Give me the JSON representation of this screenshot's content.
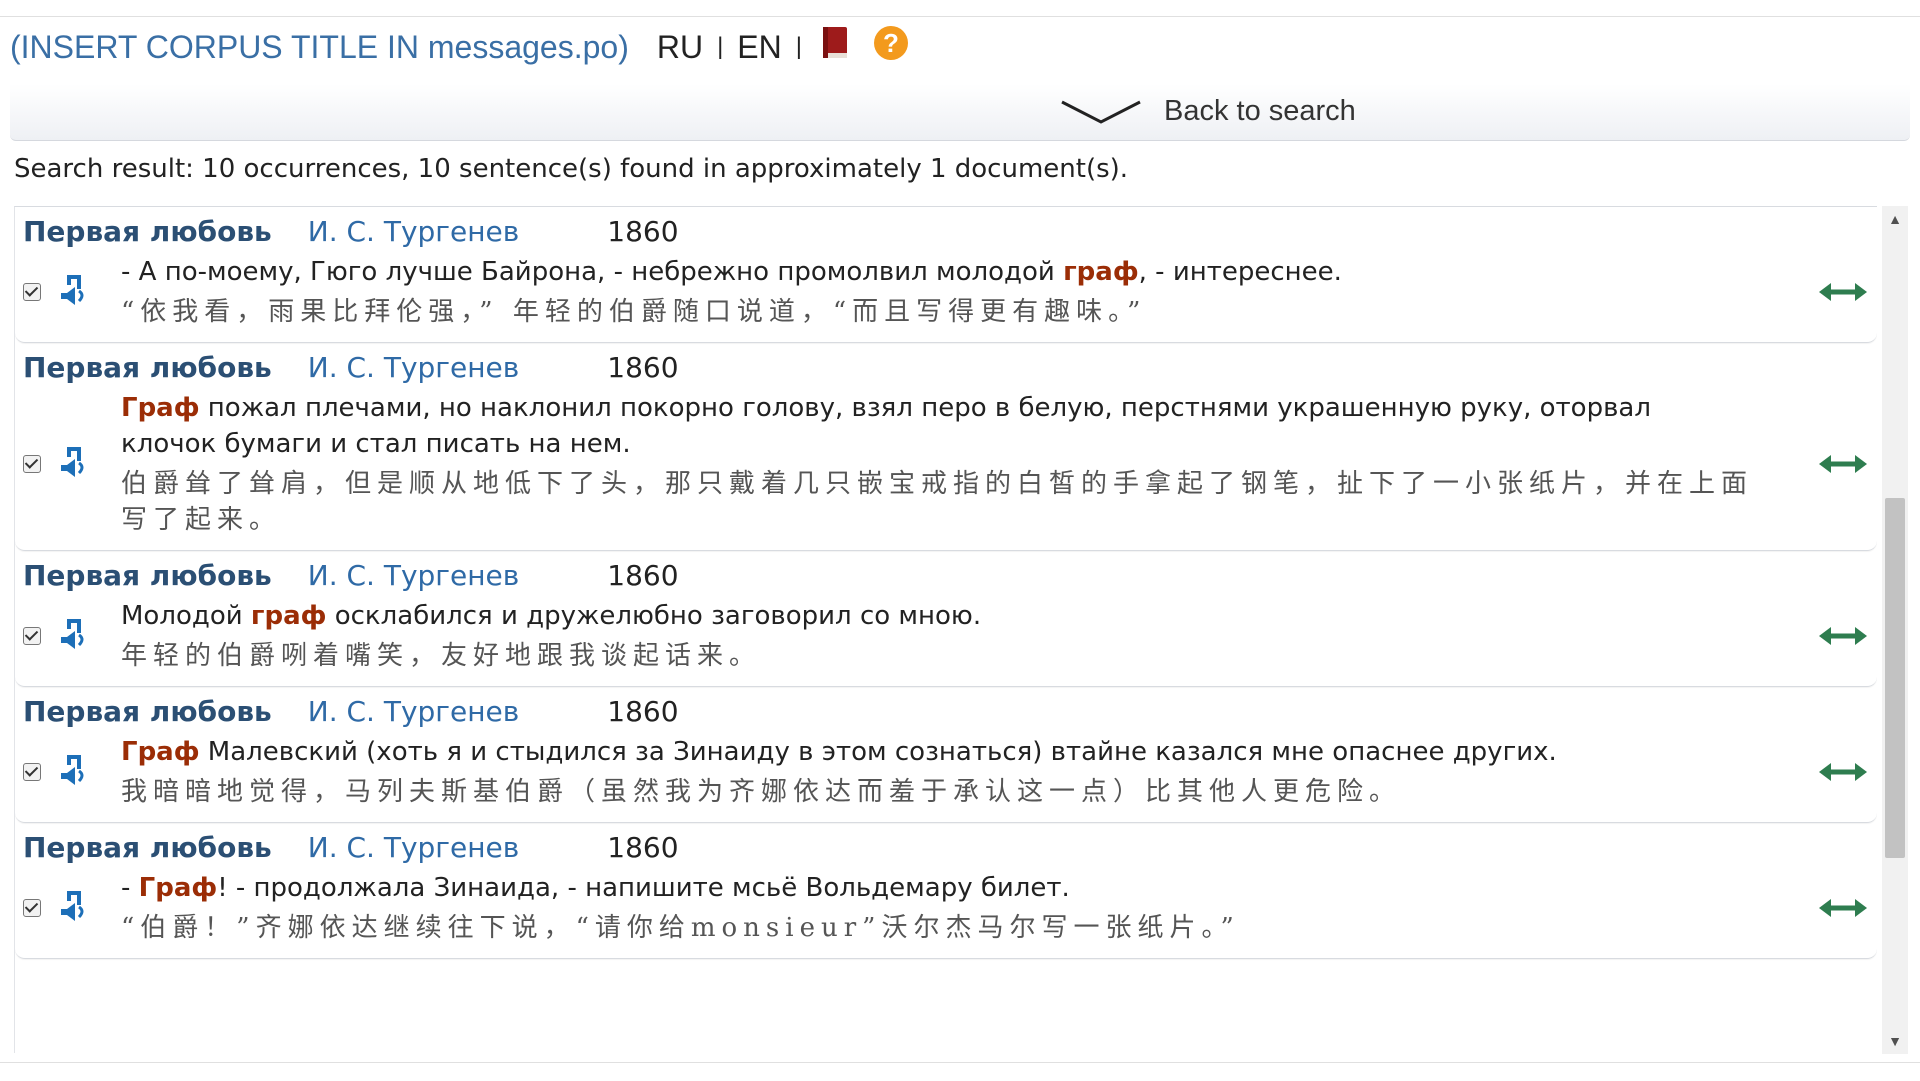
{
  "header": {
    "corpus_title": "(INSERT CORPUS TITLE IN messages.po)",
    "lang_ru": "RU",
    "lang_en": "EN",
    "separator": "|"
  },
  "back": {
    "label": "Back to search"
  },
  "summary": "Search result: 10 occurrences, 10 sentence(s) found in approximately 1 document(s).",
  "icons": {
    "book": "book-icon",
    "help": "help-icon",
    "chevron": "chevron-down-icon",
    "speaker": "speaker-icon",
    "swap": "swap-arrows-icon"
  },
  "colors": {
    "highlight": "#9b2d06",
    "title": "#2b4f74",
    "author": "#2f6aa6",
    "swap": "#2e7d4f",
    "help": "#f39a1d",
    "book": "#9e1b1b"
  },
  "results": [
    {
      "title": "Первая любовь",
      "author": "И. С. Тургенев",
      "year": "1860",
      "checked": true,
      "ru": [
        {
          "t": "- А по-моему, Гюго лучше Байрона, - небрежно промолвил молодой "
        },
        {
          "t": "граф",
          "h": true
        },
        {
          "t": ", - интереснее."
        }
      ],
      "zh": "“依我看，雨果比拜伦强，” 年轻的伯爵随口说道，“而且写得更有趣味。”"
    },
    {
      "title": "Первая любовь",
      "author": "И. С. Тургенев",
      "year": "1860",
      "checked": true,
      "ru": [
        {
          "t": "Граф",
          "h": true
        },
        {
          "t": " пожал плечами, но наклонил покорно голову, взял перо в белую, перстнями украшенную руку, оторвал клочок бумаги и стал писать на нем."
        }
      ],
      "zh": "伯爵耸了耸肩，但是顺从地低下了头，那只戴着几只嵌宝戒指的白皙的手拿起了钢笔，扯下了一小张纸片，并在上面写了起来。"
    },
    {
      "title": "Первая любовь",
      "author": "И. С. Тургенев",
      "year": "1860",
      "checked": true,
      "ru": [
        {
          "t": "Молодой "
        },
        {
          "t": "граф",
          "h": true
        },
        {
          "t": " осклабился и дружелюбно заговорил со мною."
        }
      ],
      "zh": "年轻的伯爵咧着嘴笑，友好地跟我谈起话来。"
    },
    {
      "title": "Первая любовь",
      "author": "И. С. Тургенев",
      "year": "1860",
      "checked": true,
      "ru": [
        {
          "t": "Граф",
          "h": true
        },
        {
          "t": " Малевский (хоть я и стыдился за Зинаиду в этом сознаться) втайне казался мне опаснее других."
        }
      ],
      "zh": "我暗暗地觉得，马列夫斯基伯爵（虽然我为齐娜依达而羞于承认这一点）比其他人更危险。"
    },
    {
      "title": "Первая любовь",
      "author": "И. С. Тургенев",
      "year": "1860",
      "checked": true,
      "ru": [
        {
          "t": "- "
        },
        {
          "t": "Граф",
          "h": true
        },
        {
          "t": "! - продолжала Зинаида, - напишите мсьё Вольдемару билет."
        }
      ],
      "zh": "“伯爵！”齐娜依达继续往下说，“请你给monsieur”沃尔杰马尔写一张纸片。”"
    }
  ]
}
